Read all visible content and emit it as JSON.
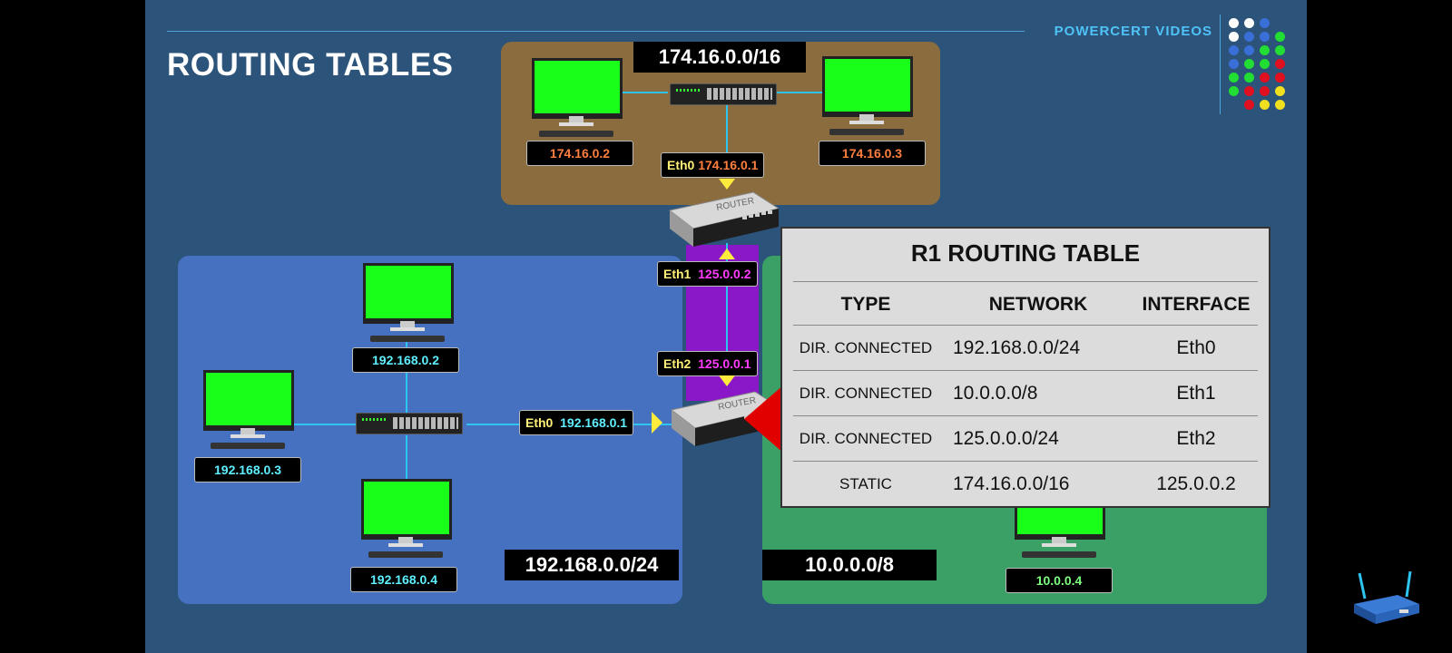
{
  "slide": {
    "title": "ROUTING TABLES",
    "brand": "POWERCERT VIDEOS"
  },
  "colors": {
    "background": "#2c5379",
    "zone_top": "#8b6c3e",
    "zone_left": "#4670c0",
    "zone_right": "#3aa065",
    "link_purple": "#8b18c8",
    "ip_orange": "#ff7f3f",
    "ip_cyan": "#5ff0ff",
    "ip_magenta": "#ff3cff",
    "ip_green": "#7fff7f",
    "eth_yellow": "#fff176"
  },
  "logo_dot_colors": [
    [
      "#ffffff",
      "#ffffff",
      "#3a6fd8",
      ""
    ],
    [
      "#ffffff",
      "#3a6fd8",
      "#3a6fd8",
      "#22dd33"
    ],
    [
      "#3a6fd8",
      "#3a6fd8",
      "#22dd33",
      "#22dd33"
    ],
    [
      "#3a6fd8",
      "#22dd33",
      "#22dd33",
      "#e01020"
    ],
    [
      "#22dd33",
      "#22dd33",
      "#e01020",
      "#e01020"
    ],
    [
      "#22dd33",
      "#e01020",
      "#e01020",
      "#f0e020"
    ],
    [
      "",
      "#e01020",
      "#f0e020",
      "#f0e020"
    ]
  ],
  "networks": {
    "top": "174.16.0.0/16",
    "left": "192.168.0.0/24",
    "right": "10.0.0.0/8"
  },
  "hosts": {
    "top_left": "174.16.0.2",
    "top_right": "174.16.0.3",
    "left_top": "192.168.0.2",
    "left_mid": "192.168.0.3",
    "left_bottom": "192.168.0.4",
    "right": "10.0.0.4"
  },
  "interfaces": {
    "r2_eth0": {
      "name": "Eth0",
      "ip": "174.16.0.1"
    },
    "r2_eth1": {
      "name": "Eth1",
      "ip": "125.0.0.2"
    },
    "r1_eth2": {
      "name": "Eth2",
      "ip": "125.0.0.1"
    },
    "r1_eth0": {
      "name": "Eth0",
      "ip": "192.168.0.1"
    }
  },
  "router_label": "ROUTER",
  "routing_table": {
    "title": "R1 ROUTING TABLE",
    "headers": [
      "TYPE",
      "NETWORK",
      "INTERFACE"
    ],
    "rows": [
      [
        "DIR. CONNECTED",
        "192.168.0.0/24",
        "Eth0"
      ],
      [
        "DIR. CONNECTED",
        "10.0.0.0/8",
        "Eth1"
      ],
      [
        "DIR. CONNECTED",
        "125.0.0.0/24",
        "Eth2"
      ],
      [
        "STATIC",
        "174.16.0.0/16",
        "125.0.0.2"
      ]
    ]
  }
}
